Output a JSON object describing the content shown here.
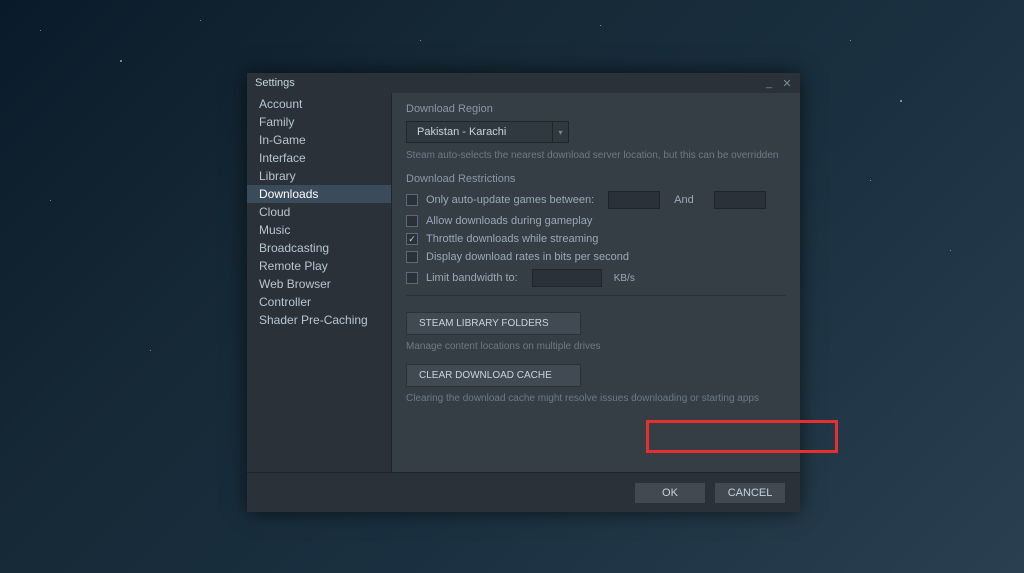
{
  "window": {
    "title": "Settings"
  },
  "sidebar": {
    "items": [
      "Account",
      "Family",
      "In-Game",
      "Interface",
      "Library",
      "Downloads",
      "Cloud",
      "Music",
      "Broadcasting",
      "Remote Play",
      "Web Browser",
      "Controller",
      "Shader Pre-Caching"
    ],
    "selected_index": 5
  },
  "content": {
    "region_header": "Download Region",
    "region_value": "Pakistan - Karachi",
    "region_hint": "Steam auto-selects the nearest download server location, but this can be overridden",
    "restrictions_header": "Download Restrictions",
    "auto_update_label": "Only auto-update games between:",
    "and_label": "And",
    "allow_gameplay_label": "Allow downloads during gameplay",
    "throttle_label": "Throttle downloads while streaming",
    "display_bits_label": "Display download rates in bits per second",
    "limit_bandwidth_label": "Limit bandwidth to:",
    "bandwidth_unit": "KB/s",
    "library_button": "STEAM LIBRARY FOLDERS",
    "library_desc": "Manage content locations on multiple drives",
    "clear_cache_button": "CLEAR DOWNLOAD CACHE",
    "clear_cache_desc": "Clearing the download cache might resolve issues downloading or starting apps",
    "checkboxes": {
      "auto_update": false,
      "allow_gameplay": false,
      "throttle": true,
      "display_bits": false,
      "limit_bandwidth": false
    }
  },
  "footer": {
    "ok": "OK",
    "cancel": "CANCEL"
  }
}
